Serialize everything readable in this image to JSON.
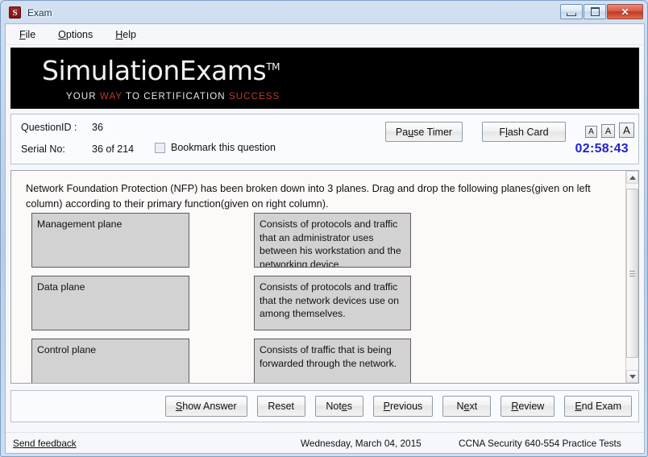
{
  "window": {
    "title": "Exam",
    "icon": "S",
    "controls": {
      "minimize": "minimize-icon",
      "maximize": "maximize-icon",
      "close": "✕"
    }
  },
  "menu": {
    "items": [
      {
        "label": "File",
        "accel": "F"
      },
      {
        "label": "Options",
        "accel": "O"
      },
      {
        "label": "Help",
        "accel": "H"
      }
    ]
  },
  "banner": {
    "logo_main": "SimulationExams",
    "logo_tm": "TM",
    "tagline_parts": [
      {
        "text": "YOUR ",
        "color": "white"
      },
      {
        "text": "WAY ",
        "color": "red"
      },
      {
        "text": "TO CERTIFICATION ",
        "color": "white"
      },
      {
        "text": "SUCCESS",
        "color": "red"
      }
    ],
    "tagline_full": "YOUR WAY TO CERTIFICATION SUCCESS",
    "accent_red": "#c0392b",
    "background": "#000000"
  },
  "info": {
    "question_id_label": "QuestionID :",
    "question_id_value": "36",
    "serial_label": "Serial No:",
    "serial_value": "36 of 214",
    "bookmark_label": "Bookmark this question",
    "bookmark_checked": false,
    "pause_timer_label": "Pause Timer",
    "pause_timer_accel": "u",
    "flash_card_label": "Flash Card",
    "flash_card_accel": "l",
    "font_buttons": [
      "A",
      "A",
      "A"
    ],
    "timer": "02:58:43",
    "timer_color": "#2222cc"
  },
  "question": {
    "text": "Network Foundation Protection (NFP) has been broken down into 3 planes. Drag and drop  the following planes(given on left column) according to their primary function(given on right column).",
    "left_items": [
      "Management plane",
      "Data plane",
      "Control plane"
    ],
    "right_items": [
      "Consists of protocols and traffic that an administrator uses between his workstation and the networking device.",
      "Consists of protocols and traffic that the network devices use on among themselves.",
      "Consists of traffic that is being forwarded through the network."
    ],
    "scroll": {
      "up_arrow": "scroll-up-icon",
      "down_arrow": "scroll-down-icon"
    }
  },
  "bottom_buttons": [
    {
      "label": "Show Answer",
      "accel": "S"
    },
    {
      "label": "Reset",
      "accel": ""
    },
    {
      "label": "Notes",
      "accel": "e"
    },
    {
      "label": "Previous",
      "accel": "P"
    },
    {
      "label": "Next",
      "accel": "e"
    },
    {
      "label": "Review",
      "accel": "R"
    },
    {
      "label": "End Exam",
      "accel": "E"
    }
  ],
  "status": {
    "feedback_link": "Send feedback",
    "date": "Wednesday, March 04, 2015",
    "product": "CCNA Security 640-554 Practice Tests"
  }
}
